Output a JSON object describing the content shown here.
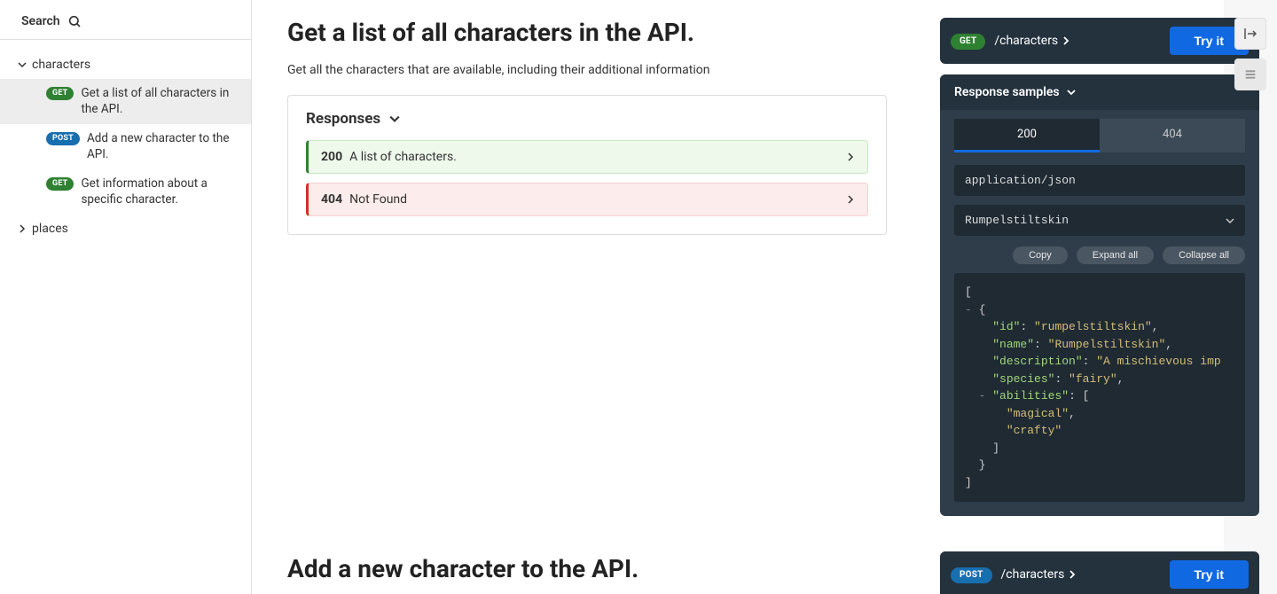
{
  "search": {
    "label": "Search"
  },
  "sidebar": {
    "groups": [
      {
        "name": "characters",
        "expanded": true,
        "items": [
          {
            "method": "GET",
            "label": "Get a list of all characters in the API."
          },
          {
            "method": "POST",
            "label": "Add a new character to the API."
          },
          {
            "method": "GET",
            "label": "Get information about a specific character."
          }
        ]
      },
      {
        "name": "places",
        "expanded": false,
        "items": []
      }
    ]
  },
  "main": {
    "title": "Get a list of all characters in the API.",
    "description": "Get all the characters that are available, including their additional information",
    "responses_header": "Responses",
    "responses": [
      {
        "code": "200",
        "text": "A list of characters."
      },
      {
        "code": "404",
        "text": "Not Found"
      }
    ],
    "section2_title": "Add a new character to the API."
  },
  "right": {
    "endpoint1": {
      "method": "GET",
      "path": "/characters",
      "try": "Try it"
    },
    "endpoint2": {
      "method": "POST",
      "path": "/characters",
      "try": "Try it"
    },
    "samples_header": "Response samples",
    "tabs": {
      "t200": "200",
      "t404": "404"
    },
    "mime": "application/json",
    "example": "Rumpelstiltskin",
    "buttons": {
      "copy": "Copy",
      "expand": "Expand all",
      "collapse": "Collapse all"
    },
    "code": {
      "l0": "[",
      "l1a": "-",
      "l1b": "{",
      "l2k": "\"id\"",
      "l2v": "\"rumpelstiltskin\"",
      "l3k": "\"name\"",
      "l3v": "\"Rumpelstiltskin\"",
      "l4k": "\"description\"",
      "l4v": "\"A mischievous imp",
      "l5k": "\"species\"",
      "l5v": "\"fairy\"",
      "l6a": "-",
      "l6k": "\"abilities\"",
      "l6b": "[",
      "l7v": "\"magical\"",
      "l8v": "\"crafty\"",
      "l9": "]",
      "l10": "}",
      "l11": "]"
    }
  }
}
